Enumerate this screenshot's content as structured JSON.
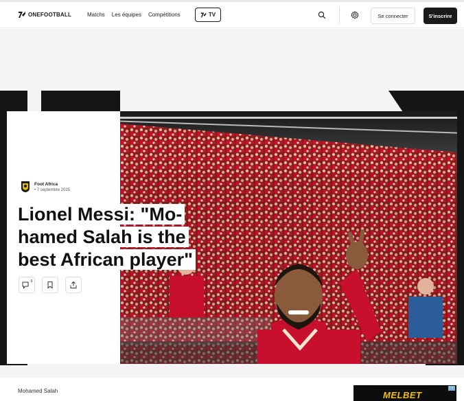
{
  "brand": {
    "name": "ONEFOOTBALL"
  },
  "nav": {
    "matches": "Matchs",
    "teams": "Les équipes",
    "competitions": "Compétitions",
    "tv": "TV"
  },
  "auth": {
    "login": "Se connecter",
    "signup": "S'inscrire"
  },
  "article": {
    "source_name": "Foot Africa",
    "date": "• 7 septembre 2025",
    "title_lines": [
      "Lionel Messi: \"Mo-",
      "hamed Salah is the",
      "best African player\""
    ],
    "comment_count": "0",
    "tag": "Mohamed Salah"
  },
  "ad": {
    "brand": "MELBET",
    "info": "i ×"
  },
  "colors": {
    "accent": "#1a1a1a",
    "kit_red": "#c8102e",
    "ad_yellow": "#f2c200"
  }
}
